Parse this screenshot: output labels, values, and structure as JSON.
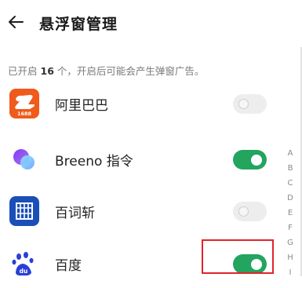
{
  "header": {
    "title": "悬浮窗管理"
  },
  "summary": {
    "prefix": "已开启",
    "count": "16",
    "suffix": "个，开启后可能会产生弹窗广告。"
  },
  "apps": [
    {
      "name": "阿里巴巴",
      "enabled": false,
      "icon": "alibaba-icon",
      "icon_text": "1688"
    },
    {
      "name": "Breeno 指令",
      "enabled": true,
      "icon": "breeno-icon"
    },
    {
      "name": "百词斩",
      "enabled": false,
      "icon": "baicizhan-icon"
    },
    {
      "name": "百度",
      "enabled": true,
      "icon": "baidu-icon",
      "icon_text": "du"
    }
  ],
  "index_letters": [
    "A",
    "B",
    "C",
    "D",
    "E",
    "F",
    "G",
    "H",
    "I"
  ],
  "colors": {
    "accent": "#23a45f",
    "highlight": "#e0252b",
    "alibaba": "#f05a1a",
    "baidu": "#2a3fd6"
  }
}
